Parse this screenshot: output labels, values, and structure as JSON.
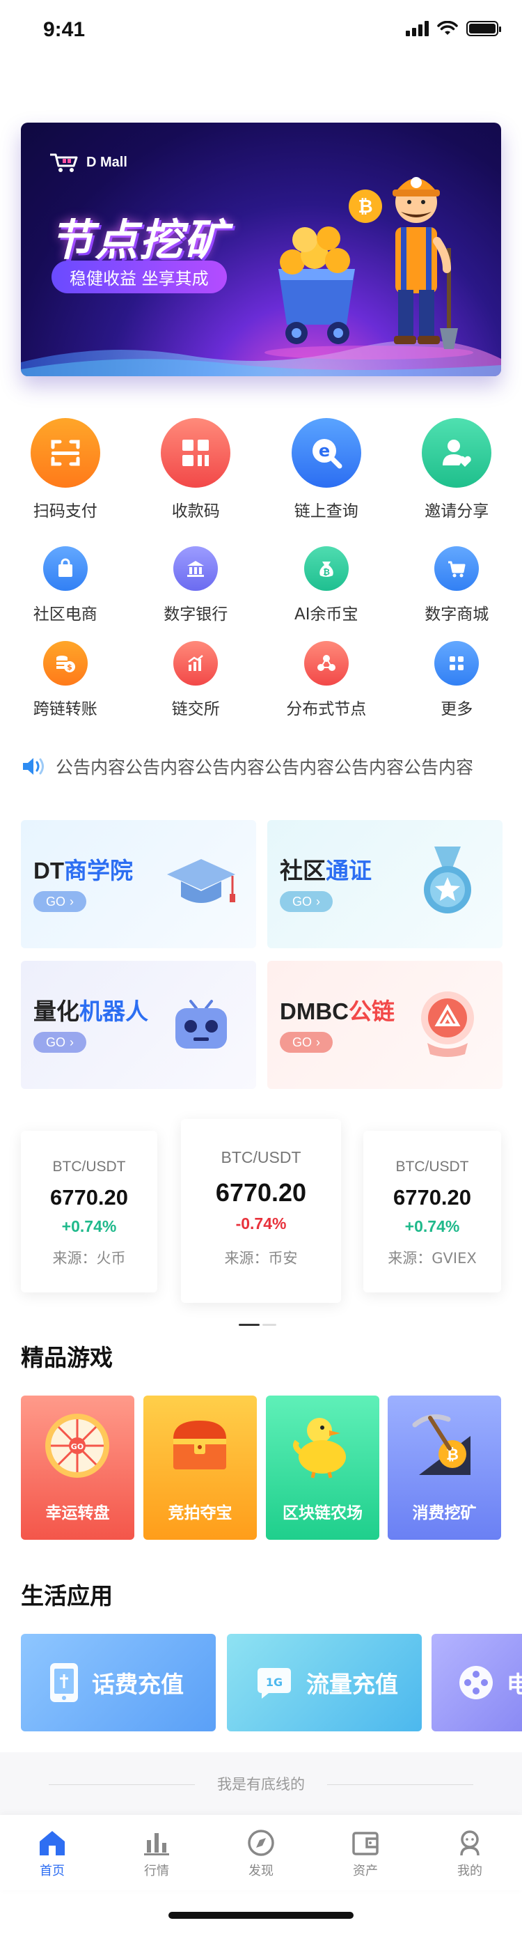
{
  "status_bar": {
    "time": "9:41"
  },
  "banner": {
    "brand": "D Mall",
    "title": "节点挖矿",
    "subtitle": "稳健收益 坐享其成"
  },
  "main_grid": [
    {
      "label": "扫码支付",
      "icon": "scan-icon",
      "color_from": "#ffa629",
      "color_to": "#ff7a1a"
    },
    {
      "label": "收款码",
      "icon": "qrcode-icon",
      "color_from": "#ff8a7a",
      "color_to": "#f24848"
    },
    {
      "label": "链上查询",
      "icon": "chain-search-icon",
      "color_from": "#5aa4ff",
      "color_to": "#2c6ef2"
    },
    {
      "label": "邀请分享",
      "icon": "invite-user-icon",
      "color_from": "#4fe0b0",
      "color_to": "#1fbf8c"
    }
  ],
  "service_grid_1": [
    {
      "label": "社区电商",
      "icon": "shopping-bag-icon",
      "color_from": "#63a8ff",
      "color_to": "#3280f4"
    },
    {
      "label": "数字银行",
      "icon": "bank-icon",
      "color_from": "#9c9cff",
      "color_to": "#6b6bf0"
    },
    {
      "label": "AI余币宝",
      "icon": "coin-bag-icon",
      "color_from": "#4fdcb0",
      "color_to": "#1fbf90"
    },
    {
      "label": "数字商城",
      "icon": "cart-icon",
      "color_from": "#63a8ff",
      "color_to": "#3280f4"
    }
  ],
  "service_grid_2": [
    {
      "label": "跨链转账",
      "icon": "coin-transfer-icon",
      "color_from": "#ffa629",
      "color_to": "#ff7a1a"
    },
    {
      "label": "链交所",
      "icon": "bar-chart-icon",
      "color_from": "#ff8a7a",
      "color_to": "#f24848"
    },
    {
      "label": "分布式节点",
      "icon": "nodes-icon",
      "color_from": "#ff8a7a",
      "color_to": "#f24848"
    },
    {
      "label": "更多",
      "icon": "grid-more-icon",
      "color_from": "#63a8ff",
      "color_to": "#3280f4"
    }
  ],
  "notice": {
    "icon": "speaker-icon",
    "text": "公告内容公告内容公告内容公告内容公告内容公告内容"
  },
  "feature_cards": [
    {
      "pre": "DT",
      "highlight": "商学院",
      "go": "GO",
      "art": "graduation-cap-icon",
      "hl_color": "#2c6ef2",
      "go_color": "#8fb6f2",
      "bg_from": "#eef7ff",
      "bg_to": "#f8fbff"
    },
    {
      "pre": "社区",
      "highlight": "通证",
      "go": "GO",
      "art": "medal-icon",
      "hl_color": "#2c6ef2",
      "go_color": "#8fcdea",
      "bg_from": "#eaf8fc",
      "bg_to": "#f6fcfe"
    },
    {
      "pre": "量化",
      "highlight": "机器人",
      "go": "GO",
      "art": "robot-icon",
      "hl_color": "#2c6ef2",
      "go_color": "#98a7ee",
      "bg_from": "#f1f2fd",
      "bg_to": "#f9f9fe"
    },
    {
      "pre": "DMBC",
      "highlight": "公链",
      "go": "GO",
      "art": "crystal-ball-icon",
      "hl_color": "#f24848",
      "go_color": "#f49a92",
      "bg_from": "#fff1ef",
      "bg_to": "#fff9f8"
    }
  ],
  "tickers": [
    {
      "pair": "BTC/USDT",
      "price": "6770.20",
      "change": "+0.74%",
      "source": "来源：火币",
      "up": true
    },
    {
      "pair": "BTC/USDT",
      "price": "6770.20",
      "change": "-0.74%",
      "source": "来源：币安",
      "up": false
    },
    {
      "pair": "BTC/USDT",
      "price": "6770.20",
      "change": "+0.74%",
      "source": "来源：GVIEX",
      "up": true
    }
  ],
  "colors": {
    "up": "#1fb98b",
    "down": "#e8323c",
    "accent": "#2e6ef2"
  },
  "games_section": {
    "title": "精品游戏",
    "items": [
      {
        "label": "幸运转盘",
        "art": "lucky-wheel-icon",
        "bg_from": "#ff9a8a",
        "bg_to": "#f4564a"
      },
      {
        "label": "竞拍夺宝",
        "art": "treasure-chest-icon",
        "bg_from": "#ffcf4a",
        "bg_to": "#ff9d1a"
      },
      {
        "label": "区块链农场",
        "art": "duck-icon",
        "bg_from": "#5ff0b8",
        "bg_to": "#1fcf8c"
      },
      {
        "label": "消费挖矿",
        "art": "pickaxe-coin-icon",
        "bg_from": "#9cb0ff",
        "bg_to": "#6a80f4"
      }
    ]
  },
  "life_section": {
    "title": "生活应用",
    "items": [
      {
        "label": "话费充值",
        "icon": "phone-recharge-icon",
        "bg_from": "#8ec6ff",
        "bg_to": "#5aa0f7"
      },
      {
        "label": "流量充值",
        "icon": "data-recharge-icon",
        "bg_from": "#8fe2f2",
        "bg_to": "#4cb8ee"
      },
      {
        "label": "电",
        "icon": "film-icon",
        "bg_from": "#b4b4ff",
        "bg_to": "#8a8af4"
      }
    ]
  },
  "footer_note": "我是有底线的",
  "tabbar": [
    {
      "label": "首页",
      "icon": "home-icon",
      "active": true
    },
    {
      "label": "行情",
      "icon": "market-chart-icon",
      "active": false
    },
    {
      "label": "发现",
      "icon": "compass-icon",
      "active": false
    },
    {
      "label": "资产",
      "icon": "wallet-icon",
      "active": false
    },
    {
      "label": "我的",
      "icon": "user-icon",
      "active": false
    }
  ]
}
